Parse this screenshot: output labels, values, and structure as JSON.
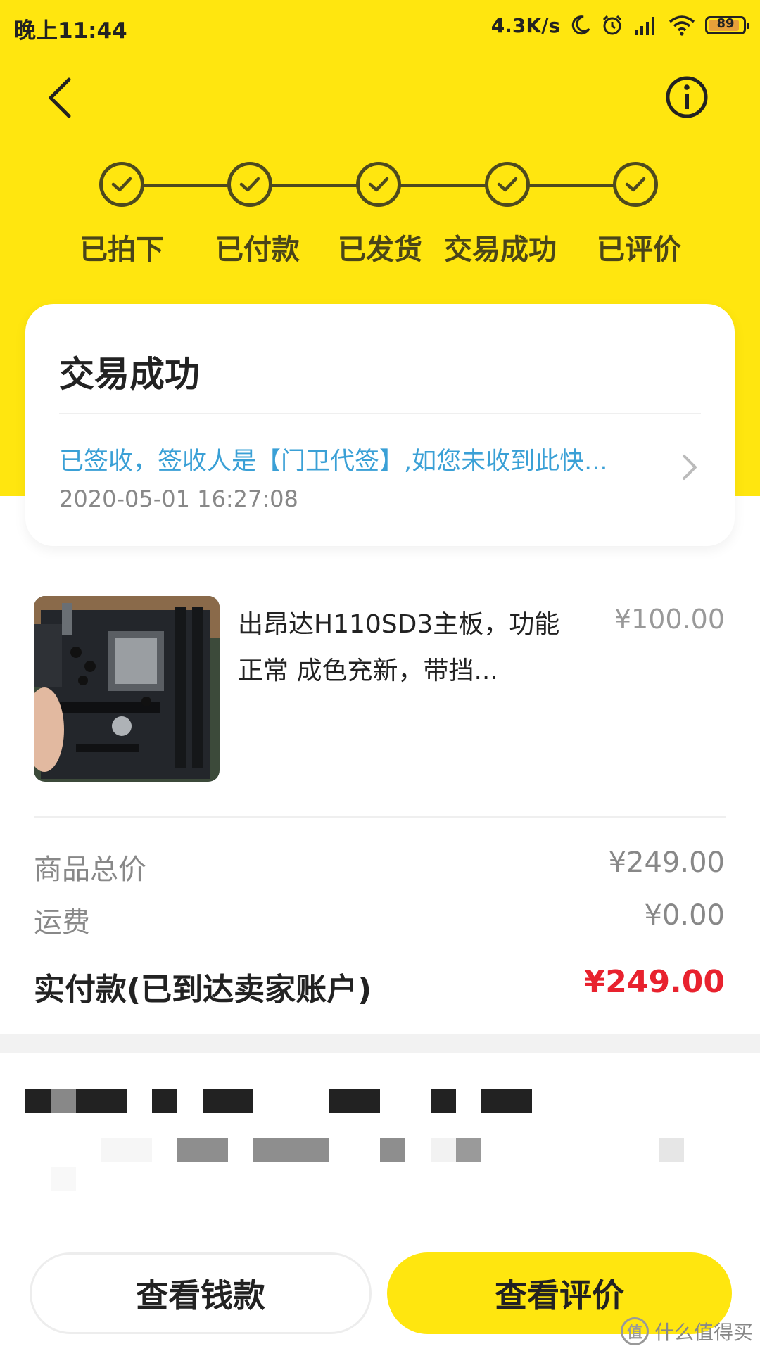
{
  "status_bar": {
    "time": "晚上11:44",
    "net_speed": "4.3K/s",
    "battery": "89",
    "battery_level": 0.89
  },
  "progress": {
    "steps": [
      {
        "label": "已拍下"
      },
      {
        "label": "已付款"
      },
      {
        "label": "已发货"
      },
      {
        "label": "交易成功"
      },
      {
        "label": "已评价"
      }
    ]
  },
  "status_card": {
    "title": "交易成功",
    "logistics_message": "已签收，签收人是【门卫代签】,如您未收到此快...",
    "logistics_time": "2020-05-01 16:27:08"
  },
  "product": {
    "title": "出昂达H110SD3主板，功能正常 成色充新，带挡...",
    "price": "¥100.00"
  },
  "summary": {
    "goods_total_label": "商品总价",
    "goods_total_value": "¥249.00",
    "shipping_label": "运费",
    "shipping_value": "¥0.00",
    "paid_label": "实付款(已到达卖家账户)",
    "paid_value": "¥249.00"
  },
  "actions": {
    "view_funds": "查看钱款",
    "view_review": "查看评价"
  },
  "watermark": {
    "badge": "值",
    "text": "什么值得买"
  },
  "colors": {
    "brand_yellow": "#FFE60F",
    "logistics_blue": "#3AA0D6",
    "price_red": "#E8222E"
  }
}
